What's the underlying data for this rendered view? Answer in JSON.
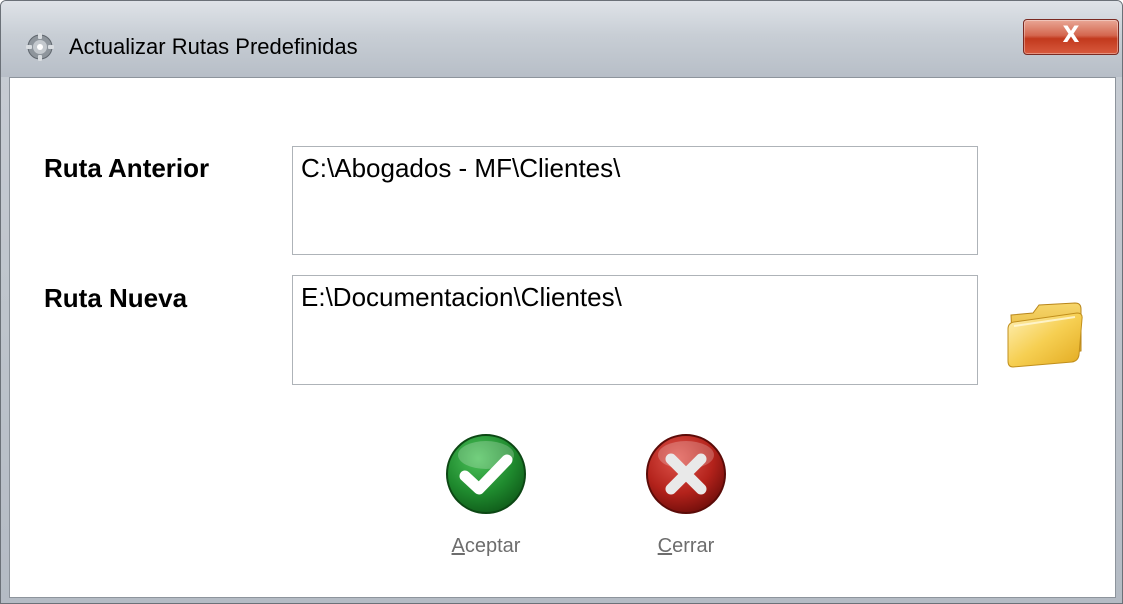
{
  "window": {
    "title": "Actualizar Rutas Predefinidas",
    "close_glyph": "X"
  },
  "form": {
    "ruta_anterior": {
      "label": "Ruta Anterior",
      "value": "C:\\Abogados - MF\\Clientes\\"
    },
    "ruta_nueva": {
      "label": "Ruta Nueva",
      "value": "E:\\Documentacion\\Clientes\\"
    }
  },
  "actions": {
    "accept": {
      "accel": "A",
      "rest": "ceptar"
    },
    "close": {
      "accel": "C",
      "rest": "errar"
    }
  },
  "icons": {
    "title": "gear-icon",
    "browse": "folder-icon",
    "accept": "checkmark-icon",
    "close": "cross-icon"
  },
  "colors": {
    "accept_green": "#1f8a2e",
    "close_red": "#b3221b",
    "folder_yellow": "#f3c63a"
  }
}
